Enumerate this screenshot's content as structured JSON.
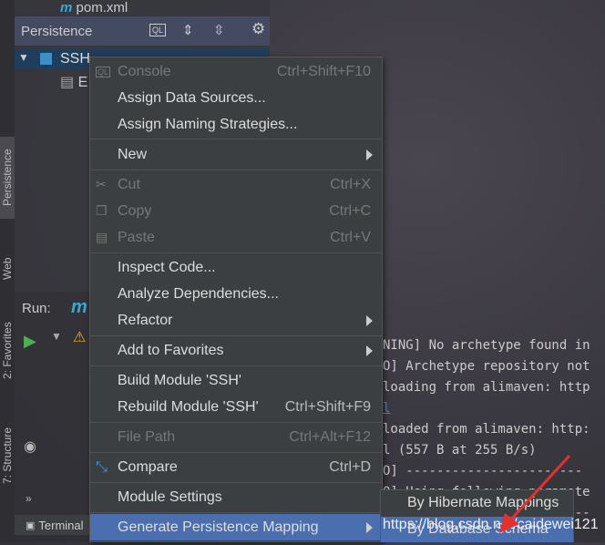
{
  "tree_top": "pom.xml",
  "panel": {
    "title": "Persistence",
    "root": "SSH",
    "child": "E"
  },
  "side_tabs": [
    "Persistence",
    "Web",
    "2: Favorites",
    "7: Structure"
  ],
  "run": {
    "label": "Run:",
    "tab_prefix": "m"
  },
  "bottom": {
    "terminal": "Terminal"
  },
  "menu": [
    {
      "label": "Console",
      "shortcut": "Ctrl+Shift+F10",
      "disabled": true,
      "icon": "ql-console-icon"
    },
    {
      "label": "Assign Data Sources..."
    },
    {
      "label": "Assign Naming Strategies..."
    },
    {
      "label": "New",
      "submenu": true
    },
    {
      "label": "Cut",
      "shortcut": "Ctrl+X",
      "disabled": true,
      "icon": "scissors-icon"
    },
    {
      "label": "Copy",
      "shortcut": "Ctrl+C",
      "disabled": true,
      "icon": "copy-icon"
    },
    {
      "label": "Paste",
      "shortcut": "Ctrl+V",
      "disabled": true,
      "icon": "paste-icon"
    },
    {
      "label": "Inspect Code..."
    },
    {
      "label": "Analyze Dependencies..."
    },
    {
      "label": "Refactor",
      "submenu": true
    },
    {
      "label": "Add to Favorites",
      "submenu": true
    },
    {
      "label": "Build Module 'SSH'"
    },
    {
      "label": "Rebuild Module 'SSH'",
      "shortcut": "Ctrl+Shift+F9"
    },
    {
      "label": "File Path",
      "shortcut": "Ctrl+Alt+F12",
      "disabled": true
    },
    {
      "label": "Compare",
      "shortcut": "Ctrl+D",
      "icon": "compare-icon"
    },
    {
      "label": "Module Settings"
    },
    {
      "label": "Generate Persistence Mapping",
      "submenu": true,
      "selected": true
    }
  ],
  "submenu": [
    "By Hibernate Mappings",
    "By Database Schema"
  ],
  "watermark": "https://blog.csdn.net/caidewei121",
  "console": [
    "NING] No archetype found in",
    "O] Archetype repository not",
    "loading from alimaven: http",
    "l",
    "loaded from alimaven: http:",
    "l (557 B at 255 B/s)",
    "O] -----------------------",
    "O] Using following paramete",
    "---------------------------"
  ]
}
